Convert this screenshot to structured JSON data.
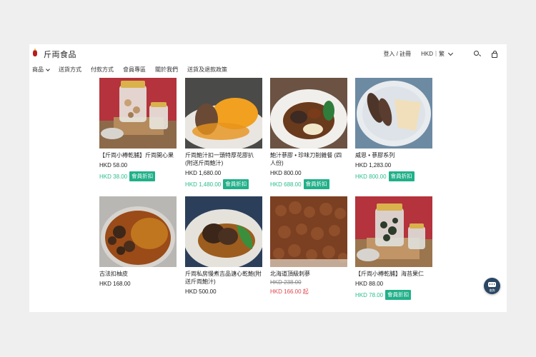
{
  "header": {
    "brand": "斤両食品",
    "login": "登入 / 註冊",
    "currency": "HKD｜繁"
  },
  "nav": [
    "商品",
    "送貨方式",
    "付款方式",
    "會員專區",
    "關於我們",
    "送貨及退款政策"
  ],
  "products": [
    {
      "name": "【斤両小樽乾脯】斤両開心果",
      "price": "HKD 58.00",
      "member_price": "HKD 38.00",
      "badge": "會員折扣"
    },
    {
      "name": "斤両鮑汁扣一頭特厚花膠扒 (附送斤両鮑汁)",
      "price": "HKD 1,680.00",
      "member_price": "HKD 1,480.00",
      "badge": "會員折扣"
    },
    {
      "name": "鮑汁蔘膠 • 珍味刀削雜餐 (四人份)",
      "price": "HKD 800.00",
      "member_price": "HKD 688.00",
      "badge": "會員折扣"
    },
    {
      "name": "威恩 • 蔘膠系列",
      "price": "HKD 1,283.00",
      "member_price": "HKD 800.00",
      "badge": "會員折扣"
    },
    {
      "name": "古法扣柚皮",
      "price": "HKD 168.00"
    },
    {
      "name": "斤両私房慢煮吉品溏心乾鮑(附送斤両鮑汁)",
      "price": "HKD 500.00"
    },
    {
      "name": "北海道頂級刺蔘",
      "original_price": "HKD 238.00",
      "sale_price": "HKD 166.00 起"
    },
    {
      "name": "【斤両小樽乾脯】海苔果仁",
      "price": "HKD 88.00",
      "member_price": "HKD 78.00",
      "badge": "會員折扣"
    }
  ],
  "chat": {
    "label": "查詢"
  },
  "colors": {
    "member": "#2bbd8c",
    "badge": "#21b089",
    "sale": "#e0454c",
    "chat": "#2a4663"
  }
}
